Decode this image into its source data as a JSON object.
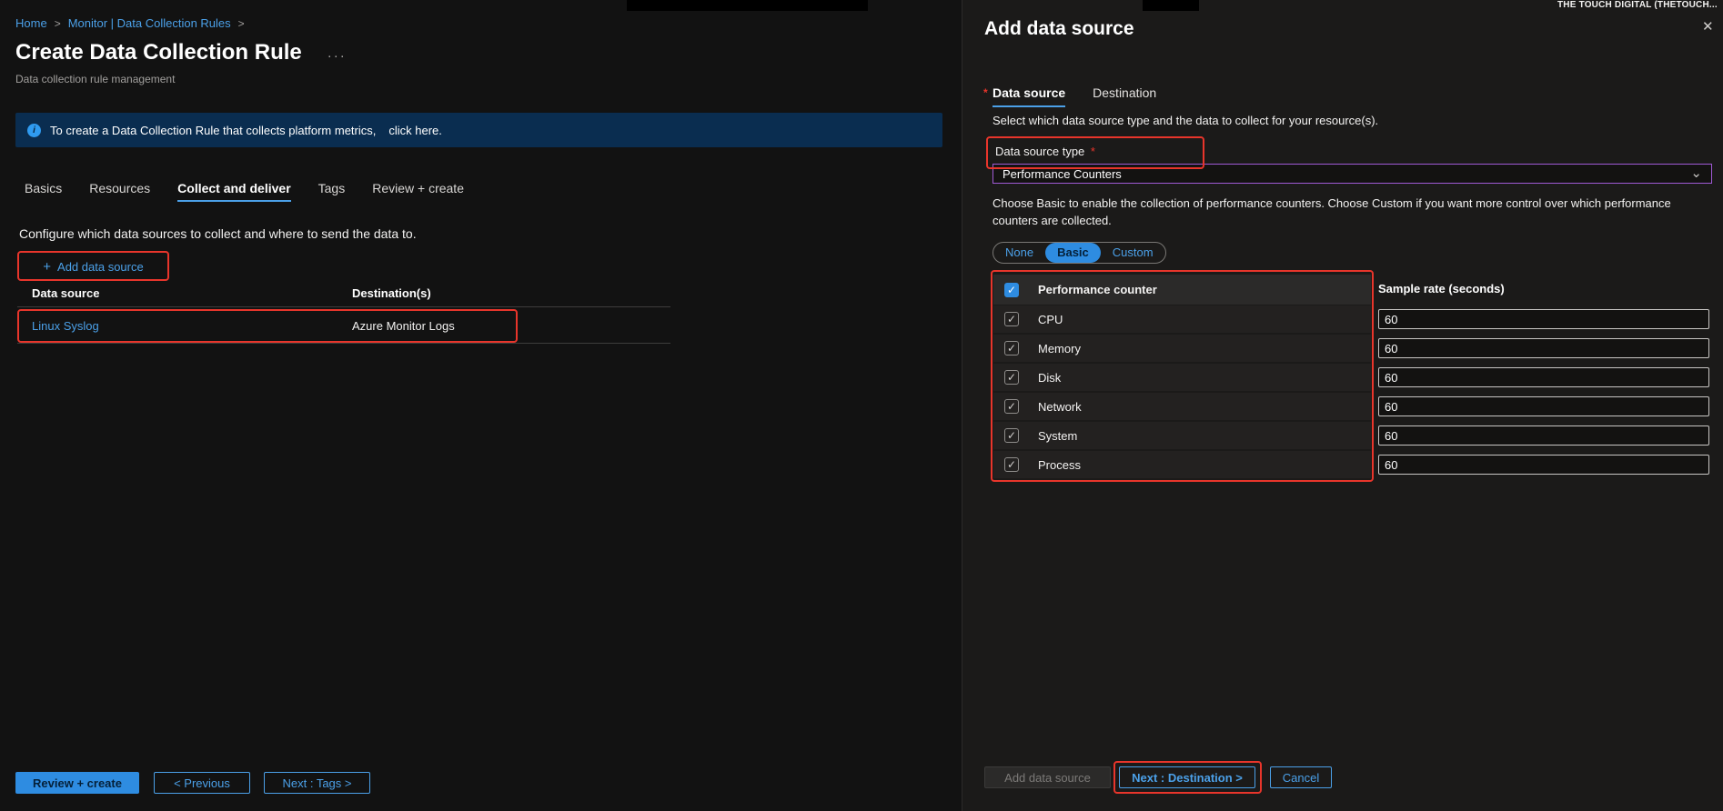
{
  "colors": {
    "annotation_red": "#e8352b",
    "dropdown_focus_purple": "#a05ad5",
    "accent_blue": "#4ba0e8",
    "primary_button_blue": "#2e8ce1",
    "banner_blue": "#0a2d50"
  },
  "chrome": {
    "account_text": "THE TOUCH DIGITAL (THETOUCH..."
  },
  "icons": {
    "info": "i",
    "close": "✕",
    "chevron_down": "⌄",
    "check": "✓",
    "plus": "+",
    "ellipsis": "···",
    "separator": ">"
  },
  "breadcrumb": {
    "home": "Home",
    "monitor": "Monitor | Data Collection Rules"
  },
  "page": {
    "title": "Create Data Collection Rule",
    "subtitle": "Data collection rule management",
    "banner": {
      "text": "To create a Data Collection Rule that collects platform metrics,",
      "link_text": "click here."
    },
    "tabs": [
      "Basics",
      "Resources",
      "Collect and deliver",
      "Tags",
      "Review + create"
    ],
    "active_tab": "Collect and deliver",
    "configure_text": "Configure which data sources to collect and where to send the data to.",
    "add_data_source_label": "Add data source",
    "table": {
      "columns": [
        "Data source",
        "Destination(s)"
      ],
      "rows": [
        {
          "source": "Linux Syslog",
          "destination": "Azure Monitor Logs"
        }
      ]
    },
    "footer": {
      "review_create": "Review + create",
      "previous": "< Previous",
      "next_tags": "Next : Tags >"
    }
  },
  "panel": {
    "title": "Add data source",
    "required_marker": "*",
    "tabs": [
      "Data source",
      "Destination"
    ],
    "active_tab": "Data source",
    "description": "Select which data source type and the data to collect for your resource(s).",
    "type_label": "Data source type",
    "type_value": "Performance Counters",
    "choose_text": "Choose Basic to enable the collection of performance counters. Choose Custom if you want more control over which performance counters are collected.",
    "pills": [
      "None",
      "Basic",
      "Custom"
    ],
    "active_pill": "Basic",
    "counter_table": {
      "header": "Performance counter",
      "sample_header": "Sample rate (seconds)",
      "rows": [
        {
          "name": "CPU",
          "rate": "60"
        },
        {
          "name": "Memory",
          "rate": "60"
        },
        {
          "name": "Disk",
          "rate": "60"
        },
        {
          "name": "Network",
          "rate": "60"
        },
        {
          "name": "System",
          "rate": "60"
        },
        {
          "name": "Process",
          "rate": "60"
        }
      ]
    },
    "footer": {
      "add": "Add data source",
      "next_destination": "Next : Destination >",
      "cancel": "Cancel"
    }
  }
}
